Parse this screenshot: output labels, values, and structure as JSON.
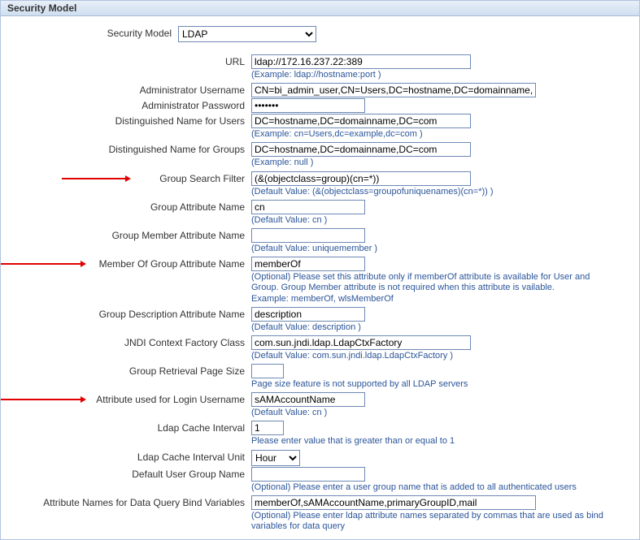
{
  "header": {
    "title": "Security Model"
  },
  "securityModel": {
    "label": "Security Model",
    "value": "LDAP"
  },
  "fields": {
    "url": {
      "label": "URL",
      "value": "ldap://172.16.237.22:389",
      "hint": "(Example: ldap://hostname:port )"
    },
    "adminUser": {
      "label": "Administrator Username",
      "value": "CN=bi_admin_user,CN=Users,DC=hostname,DC=domainname,DC=c"
    },
    "adminPass": {
      "label": "Administrator Password",
      "value": "•••••••"
    },
    "dnUsers": {
      "label": "Distinguished Name for Users",
      "value": "DC=hostname,DC=domainname,DC=com",
      "hint": "(Example: cn=Users,dc=example,dc=com )"
    },
    "dnGroups": {
      "label": "Distinguished Name for Groups",
      "value": "DC=hostname,DC=domainname,DC=com",
      "hint": "(Example: null )"
    },
    "groupFilter": {
      "label": "Group Search Filter",
      "value": "(&(objectclass=group)(cn=*))",
      "hint": "(Default Value: (&(objectclass=groupofuniquenames)(cn=*)) )"
    },
    "groupAttr": {
      "label": "Group Attribute Name",
      "value": "cn",
      "hint": "(Default Value: cn )"
    },
    "groupMemberAttr": {
      "label": "Group Member Attribute Name",
      "value": "",
      "hint": "(Default Value: uniquemember )"
    },
    "memberOfAttr": {
      "label": "Member Of Group Attribute Name",
      "value": "memberOf",
      "hint": "(Optional) Please set this attribute only if memberOf attribute is available for User and Group. Group Member attribute is not required when this attribute is vailable. Example: memberOf, wlsMemberOf"
    },
    "groupDescAttr": {
      "label": "Group Description Attribute Name",
      "value": "description",
      "hint": "(Default Value: description )"
    },
    "jndiFactory": {
      "label": "JNDI Context Factory Class",
      "value": "com.sun.jndi.ldap.LdapCtxFactory",
      "hint": "(Default Value: com.sun.jndi.ldap.LdapCtxFactory )"
    },
    "pageSize": {
      "label": "Group Retrieval Page Size",
      "value": "",
      "hint": "Page size feature is not supported by all LDAP servers"
    },
    "loginAttr": {
      "label": "Attribute used for Login Username",
      "value": "sAMAccountName",
      "hint": "(Default Value: cn )"
    },
    "cacheInterval": {
      "label": "Ldap Cache Interval",
      "value": "1",
      "hint": "Please enter value that is greater than or equal to 1"
    },
    "cacheUnit": {
      "label": "Ldap Cache Interval Unit",
      "value": "Hour"
    },
    "defaultGroup": {
      "label": "Default User Group Name",
      "value": "",
      "hint": "(Optional) Please enter a user group name that is added to all authenticated users"
    },
    "bindVars": {
      "label": "Attribute Names for Data Query Bind Variables",
      "value": "memberOf,sAMAccountName,primaryGroupID,mail",
      "hint": "(Optional) Please enter ldap attribute names separated by commas that are used as bind variables for data query"
    }
  }
}
